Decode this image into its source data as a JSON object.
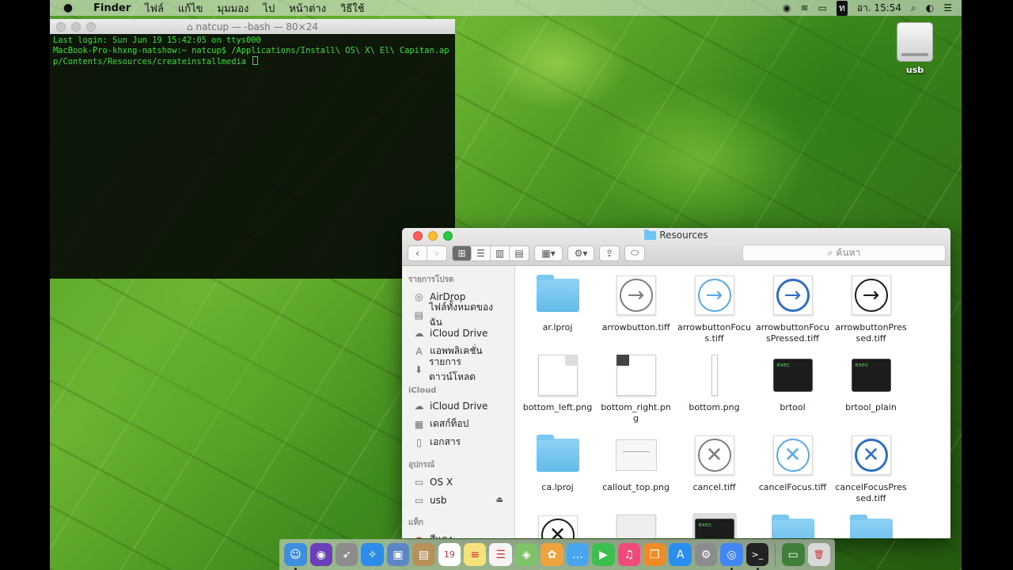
{
  "menubar": {
    "apple": "",
    "app_name": "Finder",
    "menus": [
      "ไฟล์",
      "แก้ไข",
      "มุมมอง",
      "ไป",
      "หน้าต่าง",
      "วิธีใช้"
    ],
    "clock": "อา. 15:54",
    "input_badge": "ท"
  },
  "desktop": {
    "usb_label": "usb"
  },
  "terminal": {
    "title": "natcup — -bash — 80×24",
    "lines": [
      "Last login: Sun Jun 19 15:42:05 on ttys000",
      "MacBook-Pro-khxng-natshow:~ natcup$ /Applications/Install\\ OS\\ X\\ El\\ Capitan.ap",
      "p/Contents/Resources/createinstallmedia "
    ]
  },
  "finder": {
    "title": "Resources",
    "search_placeholder": "ค้นหา",
    "sidebar": {
      "favorites_header": "รายการโปรด",
      "favorites": [
        {
          "label": "AirDrop",
          "icon": "airdrop-icon",
          "glyph": "◎"
        },
        {
          "label": "ไฟล์ทั้งหมดของฉัน",
          "icon": "all-files-icon",
          "glyph": "▤"
        },
        {
          "label": "iCloud Drive",
          "icon": "cloud-icon",
          "glyph": "☁"
        },
        {
          "label": "แอพพลิเคชั่น",
          "icon": "applications-icon",
          "glyph": "A"
        },
        {
          "label": "รายการดาวน์โหลด",
          "icon": "downloads-icon",
          "glyph": "⬇"
        }
      ],
      "icloud_header": "iCloud",
      "icloud": [
        {
          "label": "iCloud Drive",
          "icon": "cloud-icon",
          "glyph": "☁"
        },
        {
          "label": "เดสก์ท็อป",
          "icon": "desktop-icon",
          "glyph": "▦"
        },
        {
          "label": "เอกสาร",
          "icon": "documents-icon",
          "glyph": "▯"
        }
      ],
      "devices_header": "อุปกรณ์",
      "devices": [
        {
          "label": "OS X",
          "icon": "disk-icon",
          "glyph": "▭"
        },
        {
          "label": "usb",
          "icon": "disk-icon",
          "glyph": "▭"
        }
      ],
      "tags_header": "แท็ก",
      "tags": [
        {
          "label": "สีแดง",
          "icon": "tag-red-icon",
          "glyph": "●"
        }
      ]
    },
    "files": [
      {
        "name": "ar.lproj",
        "kind": "folder"
      },
      {
        "name": "arrowbutton.tiff",
        "kind": "arrow-gray"
      },
      {
        "name": "arrowbuttonFocus.tiff",
        "kind": "arrow-lblue"
      },
      {
        "name": "arrowbuttonFocusPressed.tiff",
        "kind": "arrow-blue"
      },
      {
        "name": "arrowbuttonPressed.tiff",
        "kind": "arrow-black"
      },
      {
        "name": "bottom_left.png",
        "kind": "page-left"
      },
      {
        "name": "bottom_right.png",
        "kind": "page-right"
      },
      {
        "name": "bottom.png",
        "kind": "thin"
      },
      {
        "name": "brtool",
        "kind": "exec"
      },
      {
        "name": "brtool_plain",
        "kind": "exec"
      },
      {
        "name": "ca.lproj",
        "kind": "folder"
      },
      {
        "name": "callout_top.png",
        "kind": "callout"
      },
      {
        "name": "cancel.tiff",
        "kind": "cancel-gray"
      },
      {
        "name": "cancelFocus.tiff",
        "kind": "cancel-lblue"
      },
      {
        "name": "cancelFocusPressed.tiff",
        "kind": "cancel-blue"
      },
      {
        "name": "",
        "kind": "cancel-black"
      },
      {
        "name": "",
        "kind": "blank"
      },
      {
        "name": "",
        "kind": "exec-selected"
      },
      {
        "name": "",
        "kind": "folder"
      },
      {
        "name": "",
        "kind": "folder"
      }
    ],
    "exec_text": "exec"
  },
  "dock": {
    "apps": [
      {
        "name": "finder",
        "color": "#3d8de0",
        "glyph": "☺",
        "running": true
      },
      {
        "name": "siri",
        "color": "#6b3fb8",
        "glyph": "◉",
        "running": false
      },
      {
        "name": "launchpad",
        "color": "#8c8c8c",
        "glyph": "➶",
        "running": false
      },
      {
        "name": "safari",
        "color": "#2d8ce8",
        "glyph": "✧",
        "running": false
      },
      {
        "name": "preview",
        "color": "#5b87c4",
        "glyph": "▣",
        "running": false
      },
      {
        "name": "contacts",
        "color": "#b8915a",
        "glyph": "▤",
        "running": false
      },
      {
        "name": "calendar",
        "color": "#ffffff",
        "glyph": "19",
        "running": false
      },
      {
        "name": "notes",
        "color": "#f6e27a",
        "glyph": "≡",
        "running": false
      },
      {
        "name": "reminders",
        "color": "#f4f4f4",
        "glyph": "☰",
        "running": false
      },
      {
        "name": "maps",
        "color": "#7ec36a",
        "glyph": "◈",
        "running": false
      },
      {
        "name": "photos",
        "color": "#f0a23c",
        "glyph": "✿",
        "running": false
      },
      {
        "name": "messages",
        "color": "#4aa5f0",
        "glyph": "…",
        "running": false
      },
      {
        "name": "facetime",
        "color": "#3cbf4f",
        "glyph": "▶",
        "running": false
      },
      {
        "name": "itunes",
        "color": "#f04a7a",
        "glyph": "♫",
        "running": false
      },
      {
        "name": "ibooks",
        "color": "#f08c28",
        "glyph": "❒",
        "running": false
      },
      {
        "name": "app-store",
        "color": "#2a8df0",
        "glyph": "A",
        "running": false
      },
      {
        "name": "system-preferences",
        "color": "#8c8c8c",
        "glyph": "⚙",
        "running": false
      },
      {
        "name": "chrome",
        "color": "#4285f4",
        "glyph": "◎",
        "running": true
      },
      {
        "name": "terminal",
        "color": "#222222",
        "glyph": ">_",
        "running": true
      }
    ],
    "extras": [
      {
        "name": "downloads-stack",
        "color": "#3f7f3a",
        "glyph": "▭"
      },
      {
        "name": "trash",
        "color": "#d8d8d8",
        "glyph": "🗑"
      }
    ]
  }
}
